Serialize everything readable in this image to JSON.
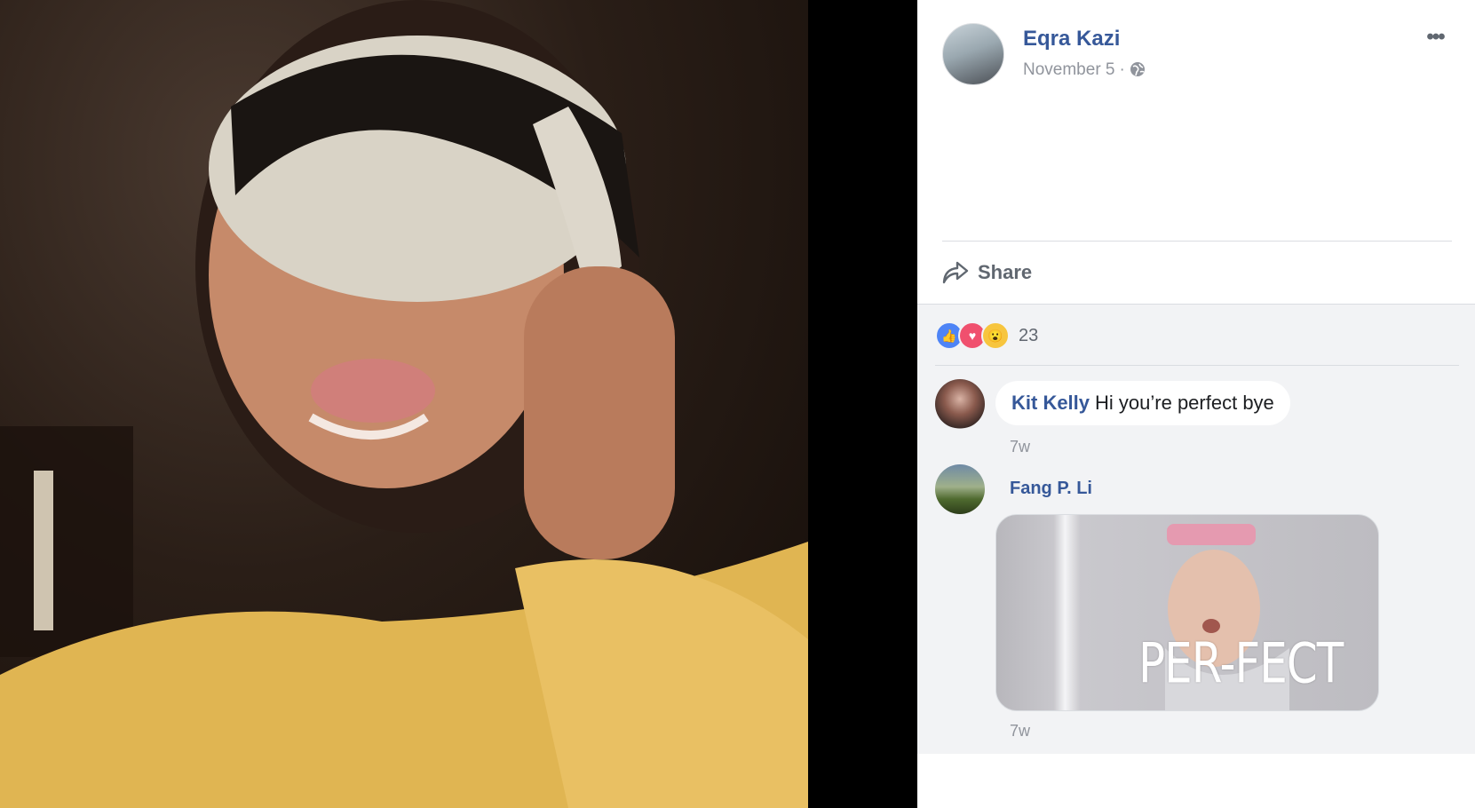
{
  "post": {
    "author": "Eqra Kazi",
    "date": "November 5",
    "separator": "·",
    "more_label": "•••",
    "share_label": "Share"
  },
  "reactions": {
    "count": "23",
    "icons": [
      "like-icon",
      "love-icon",
      "wow-icon"
    ]
  },
  "comments": [
    {
      "author": "Kit Kelly",
      "text": "Hi you’re perfect bye",
      "time": "7w"
    },
    {
      "author": "Fang P. Li",
      "gif_text": "PER-FECT",
      "time": "7w"
    }
  ],
  "colors": {
    "link_blue": "#365899",
    "meta_gray": "#90949c",
    "comments_bg": "#f2f3f5",
    "like": "#4e84f6",
    "love": "#f0506e",
    "wow": "#f7c53e"
  }
}
